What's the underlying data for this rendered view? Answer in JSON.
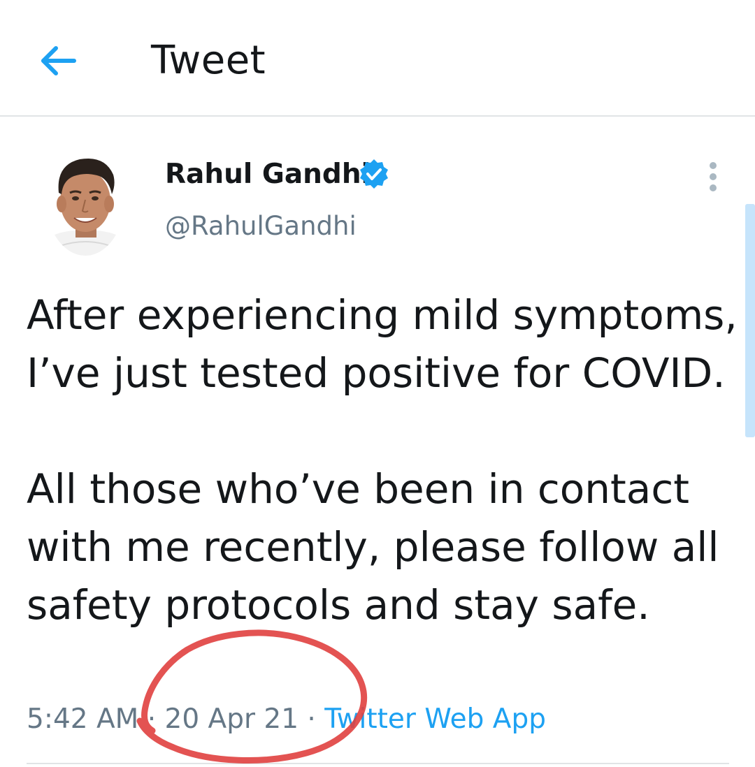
{
  "header": {
    "title": "Tweet",
    "back_icon": "arrow-left-icon",
    "accent_color": "#1da1f2"
  },
  "tweet": {
    "author": {
      "name": "Rahul Gandhi",
      "handle": "@RahulGandhi",
      "verified": true,
      "verified_icon": "verified-badge-icon",
      "avatar_icon": "avatar"
    },
    "text": "After experiencing mild symptoms, I’ve just tested positive for COVID.\n\nAll those who’ve been in contact with me recently, please follow all safety protocols and stay safe.",
    "time": "5:42 AM",
    "separator": " · ",
    "date": "20 Apr 21",
    "source": "Twitter Web App",
    "more_icon": "more-vertical-icon"
  },
  "annotation": {
    "type": "hand-drawn circle",
    "color": "#e0403f"
  }
}
